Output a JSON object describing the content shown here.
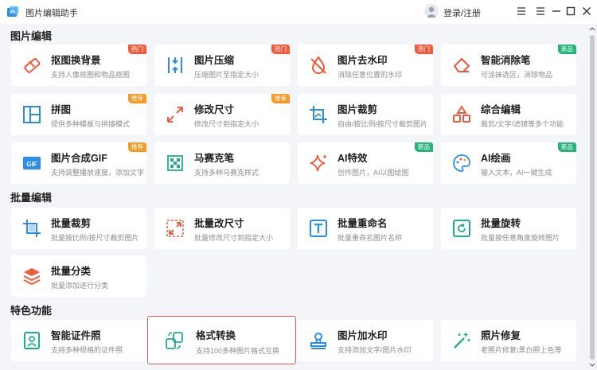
{
  "app": {
    "title": "图片编辑助手",
    "login": "登录/注册"
  },
  "sections": [
    {
      "title": "图片编辑"
    },
    {
      "title": "批量编辑"
    },
    {
      "title": "特色功能"
    }
  ],
  "cards": [
    {
      "title": "抠图换背景",
      "desc": "支持人像抠图和物品抠图",
      "icon": "eraser-icon",
      "badge": "热门",
      "badge_type": "hot"
    },
    {
      "title": "图片压缩",
      "desc": "压缩图片至指定大小",
      "icon": "compress-icon",
      "badge": "热门",
      "badge_type": "hot"
    },
    {
      "title": "图片去水印",
      "desc": "消除任意位置的水印",
      "icon": "drop-slash-icon",
      "badge": "热门",
      "badge_type": "hot"
    },
    {
      "title": "智能消除笔",
      "desc": "可涂抹选区，消除物品",
      "icon": "eraser-pen-icon",
      "badge": "新品",
      "badge_type": "new"
    },
    {
      "title": "拼图",
      "desc": "提供多种模板与拼接模式",
      "icon": "layout-icon",
      "badge": "推荐",
      "badge_type": "rec"
    },
    {
      "title": "修改尺寸",
      "desc": "修改尺寸到指定大小",
      "icon": "resize-icon",
      "badge": "推荐",
      "badge_type": "rec"
    },
    {
      "title": "图片裁剪",
      "desc": "自由/按比例/按尺寸裁剪图片",
      "icon": "crop-icon",
      "badge": "",
      "badge_type": ""
    },
    {
      "title": "综合编辑",
      "desc": "裁剪/文字/滤镜等多个功能",
      "icon": "shapes-icon",
      "badge": "",
      "badge_type": ""
    },
    {
      "title": "图片合成GIF",
      "desc": "支持调整播放速度，添加文字",
      "icon": "gif-icon",
      "badge": "推荐",
      "badge_type": "rec"
    },
    {
      "title": "马赛克笔",
      "desc": "支持多种马赛克样式",
      "icon": "mosaic-icon",
      "badge": "",
      "badge_type": ""
    },
    {
      "title": "AI特效",
      "desc": "创作图片，AI以图绘图",
      "icon": "sparkle-icon",
      "badge": "新品",
      "badge_type": "new"
    },
    {
      "title": "AI绘画",
      "desc": "输入文本，AI一键生成",
      "icon": "palette-icon",
      "badge": "新品",
      "badge_type": "new"
    },
    {
      "title": "批量裁剪",
      "desc": "批量按比例/按尺寸裁剪图片",
      "icon": "batch-crop-icon",
      "badge": "",
      "badge_type": ""
    },
    {
      "title": "批量改尺寸",
      "desc": "批量修改尺寸到指定大小",
      "icon": "batch-resize-icon",
      "badge": "",
      "badge_type": ""
    },
    {
      "title": "批量重命名",
      "desc": "批量重命名图片名称",
      "icon": "rename-icon",
      "badge": "",
      "badge_type": ""
    },
    {
      "title": "批量旋转",
      "desc": "批量按任意角度旋转图片",
      "icon": "rotate-icon",
      "badge": "",
      "badge_type": ""
    },
    {
      "title": "批量分类",
      "desc": "批量添加进行分类",
      "icon": "layers-icon",
      "badge": "",
      "badge_type": ""
    },
    {
      "title": "智能证件照",
      "desc": "支持多种规格的证件照",
      "icon": "id-photo-icon",
      "badge": "",
      "badge_type": ""
    },
    {
      "title": "格式转换",
      "desc": "支持100多种图片格式互换",
      "icon": "convert-icon",
      "badge": "",
      "badge_type": ""
    },
    {
      "title": "图片加水印",
      "desc": "支持添加文字/图片水印",
      "icon": "stamp-icon",
      "badge": "",
      "badge_type": ""
    },
    {
      "title": "照片修复",
      "desc": "老照片修复/黑白照上色等",
      "icon": "magic-wand-icon",
      "badge": "",
      "badge_type": ""
    }
  ]
}
